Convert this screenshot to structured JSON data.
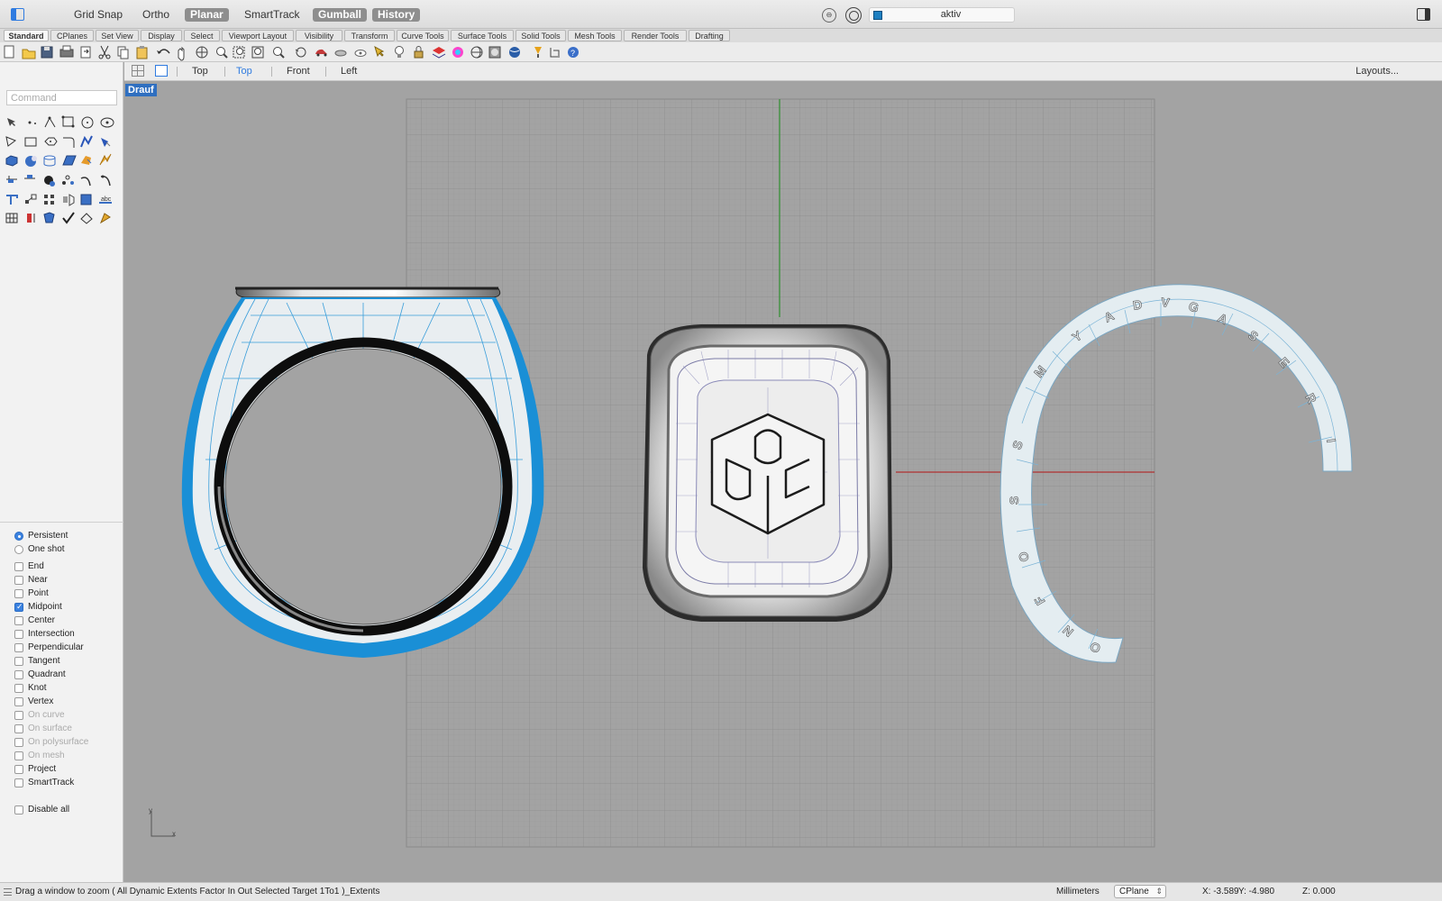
{
  "titlebar": {
    "modes": [
      {
        "label": "Grid Snap",
        "on": false
      },
      {
        "label": "Ortho",
        "on": false
      },
      {
        "label": "Planar",
        "on": true
      },
      {
        "label": "SmartTrack",
        "on": false
      },
      {
        "label": "Gumball",
        "on": true
      },
      {
        "label": "History",
        "on": true
      }
    ],
    "layer": {
      "name": "aktiv",
      "color": "#1d7fc1"
    }
  },
  "tabs": [
    "Standard",
    "CPlanes",
    "Set View",
    "Display",
    "Select",
    "Viewport Layout",
    "Visibility",
    "Transform",
    "Curve Tools",
    "Surface Tools",
    "Solid Tools",
    "Mesh Tools",
    "Render Tools",
    "Drafting"
  ],
  "active_tab": "Standard",
  "toolbar_icons": [
    "new-icon",
    "open-icon",
    "save-icon",
    "print-icon",
    "import-icon",
    "cut-icon",
    "copy-icon",
    "paste-icon",
    "undo-icon",
    "pan-icon",
    "rotate-view-icon",
    "zoom-icon",
    "zoom-window-icon",
    "zoom-extents-icon",
    "zoom-selected-icon",
    "undo-view-icon",
    "car-icon",
    "hide-icon",
    "show-icon",
    "select-icon",
    "lightbulb-icon",
    "lock-icon",
    "layer-icon",
    "color-wheel-icon",
    "render-icon",
    "material-icon",
    "environment-icon",
    "properties-icon",
    "dimension-icon",
    "help-icon"
  ],
  "command": {
    "placeholder": "Command",
    "value": ""
  },
  "osnap": {
    "mode": [
      {
        "label": "Persistent",
        "on": true
      },
      {
        "label": "One shot",
        "on": false
      }
    ],
    "items": [
      {
        "label": "End",
        "checked": false,
        "disabled": false
      },
      {
        "label": "Near",
        "checked": false,
        "disabled": false
      },
      {
        "label": "Point",
        "checked": false,
        "disabled": false
      },
      {
        "label": "Midpoint",
        "checked": true,
        "disabled": false
      },
      {
        "label": "Center",
        "checked": false,
        "disabled": false
      },
      {
        "label": "Intersection",
        "checked": false,
        "disabled": false
      },
      {
        "label": "Perpendicular",
        "checked": false,
        "disabled": false
      },
      {
        "label": "Tangent",
        "checked": false,
        "disabled": false
      },
      {
        "label": "Quadrant",
        "checked": false,
        "disabled": false
      },
      {
        "label": "Knot",
        "checked": false,
        "disabled": false
      },
      {
        "label": "Vertex",
        "checked": false,
        "disabled": false
      },
      {
        "label": "On curve",
        "checked": false,
        "disabled": true
      },
      {
        "label": "On surface",
        "checked": false,
        "disabled": true
      },
      {
        "label": "On polysurface",
        "checked": false,
        "disabled": true
      },
      {
        "label": "On mesh",
        "checked": false,
        "disabled": true
      },
      {
        "label": "Project",
        "checked": false,
        "disabled": false
      },
      {
        "label": "SmartTrack",
        "checked": false,
        "disabled": false
      }
    ],
    "disable_all": "Disable all"
  },
  "viewport_tabs": {
    "items": [
      "Top",
      "Top",
      "Front",
      "Left"
    ],
    "active_index": 1,
    "layouts": "Layouts..."
  },
  "viewport": {
    "label": "Drauf",
    "axis_y": "y",
    "axis_x": "x",
    "x_axis_color": "#b03030",
    "y_axis_color": "#2f8f2f",
    "selection_color": "#1a8fd6"
  },
  "status": {
    "message": "Drag a window to zoom ( All Dynamic Extents Factor In Out Selected Target 1To1 )_Extents",
    "units": "Millimeters",
    "cplane": "CPlane",
    "x": "X: -3.589",
    "y": "Y: -4.980",
    "z": "Z: 0.000"
  }
}
